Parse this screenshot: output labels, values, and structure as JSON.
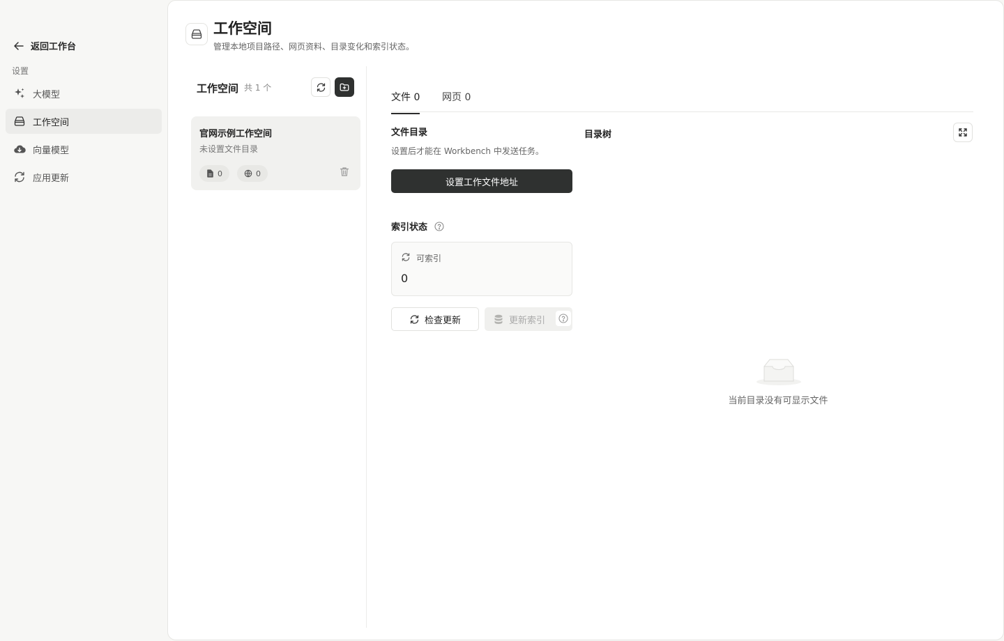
{
  "sidebar": {
    "back_label": "返回工作台",
    "section_label": "设置",
    "items": [
      {
        "label": "大模型",
        "icon": "sparkles-icon"
      },
      {
        "label": "工作空间",
        "icon": "drawer-icon",
        "active": true
      },
      {
        "label": "向量模型",
        "icon": "cloud-download-icon"
      },
      {
        "label": "应用更新",
        "icon": "refresh-icon"
      }
    ]
  },
  "header": {
    "title": "工作空间",
    "subtitle": "管理本地项目路径、网页资料、目录变化和索引状态。"
  },
  "workspace_list": {
    "title": "工作空间",
    "count_label": "共 1 个",
    "cards": [
      {
        "name": "官网示例工作空间",
        "subtitle": "未设置文件目录",
        "file_count": "0",
        "web_count": "0"
      }
    ]
  },
  "tabs": [
    {
      "label": "文件 0",
      "active": true
    },
    {
      "label": "网页 0",
      "active": false
    }
  ],
  "files": {
    "dir_title": "文件目录",
    "dir_desc": "设置后才能在 Workbench 中发送任务。",
    "set_dir_button": "设置工作文件地址",
    "index_title": "索引状态",
    "indexable_label": "可索引",
    "indexable_value": "0",
    "check_update_button": "检查更新",
    "update_index_button": "更新索引"
  },
  "tree": {
    "title": "目录树",
    "empty_text": "当前目录没有可显示文件"
  },
  "colors": {
    "accent_dark": "#2f3130",
    "background": "#f7f7f5",
    "panel": "#ffffff"
  }
}
